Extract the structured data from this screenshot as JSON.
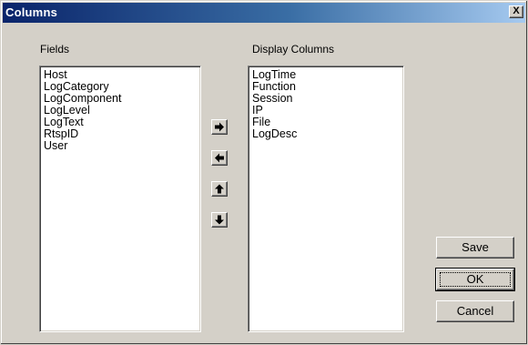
{
  "window": {
    "title": "Columns",
    "close_label": "X"
  },
  "fields": {
    "label": "Fields",
    "items": [
      "Host",
      "LogCategory",
      "LogComponent",
      "LogLevel",
      "LogText",
      "RtspID",
      "User"
    ]
  },
  "display_columns": {
    "label": "Display Columns",
    "items": [
      "LogTime",
      "Function",
      "Session",
      "IP",
      "File",
      "LogDesc"
    ]
  },
  "arrows": [
    {
      "name": "move-right",
      "icon": "arrow-right-icon"
    },
    {
      "name": "move-left",
      "icon": "arrow-left-icon"
    },
    {
      "name": "move-up",
      "icon": "arrow-up-icon"
    },
    {
      "name": "move-down",
      "icon": "arrow-down-icon"
    }
  ],
  "buttons": {
    "save": "Save",
    "ok": "OK",
    "cancel": "Cancel"
  }
}
